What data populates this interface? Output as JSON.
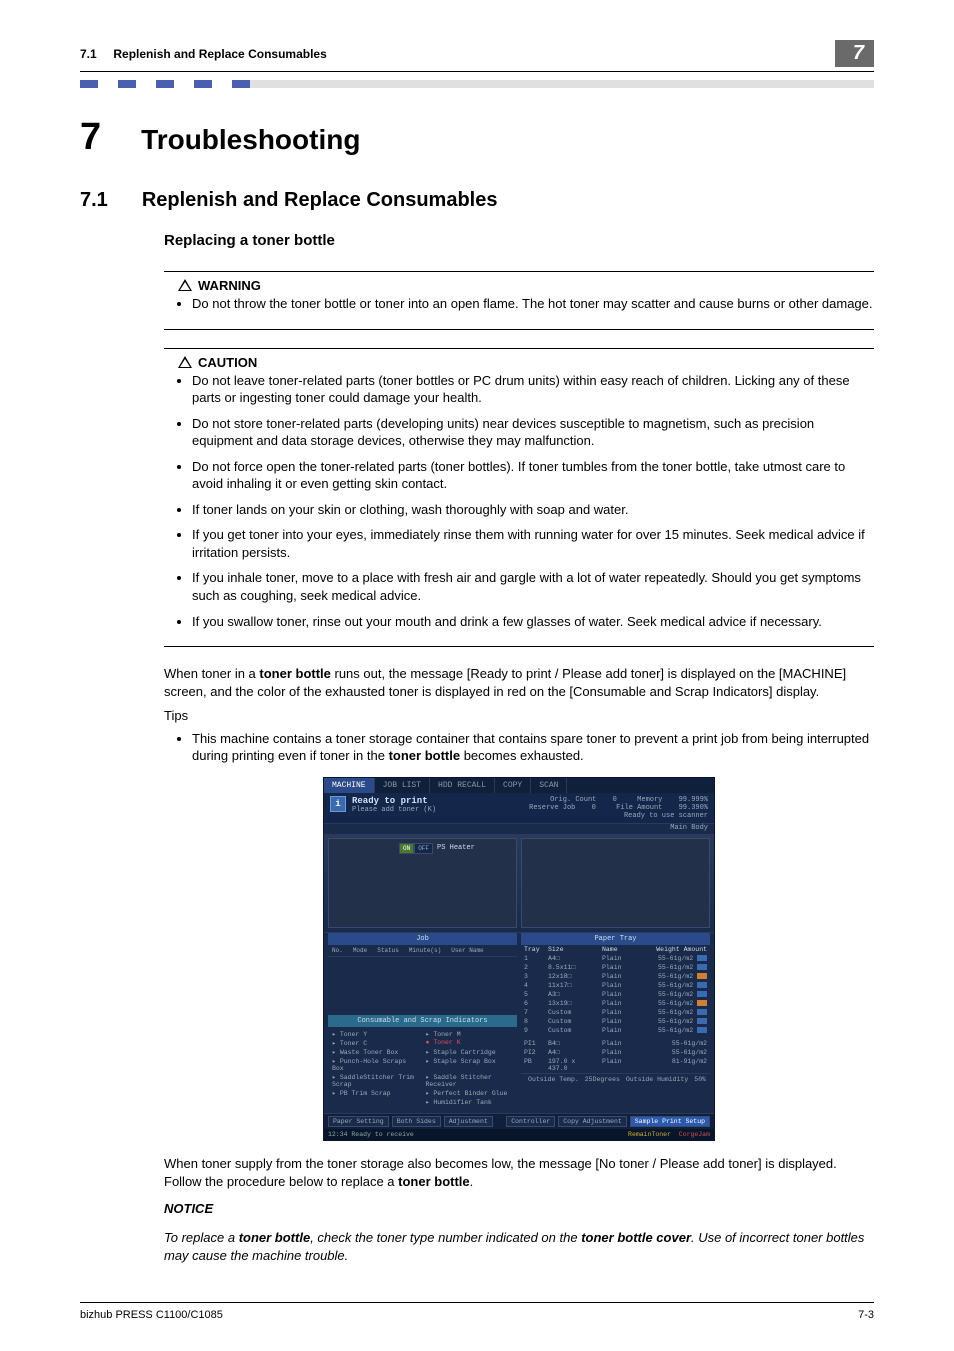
{
  "header": {
    "section_ref": "7.1",
    "section_name": "Replenish and Replace Consumables",
    "chapter_badge": "7"
  },
  "chapter": {
    "num": "7",
    "title": "Troubleshooting"
  },
  "section": {
    "num": "7.1",
    "title": "Replenish and Replace Consumables"
  },
  "subheading": "Replacing a toner bottle",
  "warning": {
    "label": "WARNING",
    "items": [
      "Do not throw the toner bottle or toner into an open flame. The hot toner may scatter and cause burns or other damage."
    ]
  },
  "caution": {
    "label": "CAUTION",
    "items": [
      "Do not leave toner-related parts (toner bottles or PC drum units) within easy reach of children. Licking any of these parts or ingesting toner could damage your health.",
      "Do not store toner-related parts (developing units) near devices susceptible to magnetism, such as precision equipment and data storage devices, otherwise they may malfunction.",
      "Do not force open the toner-related parts (toner bottles). If toner tumbles from the toner bottle, take utmost care to avoid inhaling it or even getting skin contact.",
      "If toner lands on your skin or clothing, wash thoroughly with soap and water.",
      "If you get toner into your eyes, immediately rinse them with running water for over 15 minutes. Seek medical advice if irritation persists.",
      "If you inhale toner, move to a place with fresh air and gargle with a lot of water repeatedly. Should you get symptoms such as coughing, seek medical advice.",
      "If you swallow toner, rinse out your mouth and drink a few glasses of water. Seek medical advice if necessary."
    ]
  },
  "body": {
    "p1a": "When toner in a ",
    "p1b": "toner bottle",
    "p1c": " runs out, the message [Ready to print / Please add toner] is displayed on the [MACHINE] screen, and the color of the exhausted toner is displayed in red on the [Consumable and Scrap Indicators] display.",
    "tips_label": "Tips",
    "tip1a": "This machine contains a toner storage container that contains spare toner to prevent a print job from being interrupted during printing even if toner in the ",
    "tip1b": "toner bottle",
    "tip1c": " becomes exhausted.",
    "p2a": "When toner supply from the toner storage also becomes low, the message [No toner / Please add toner] is displayed. Follow the procedure below to replace a ",
    "p2b": "toner bottle",
    "p2c": ".",
    "notice_head": "NOTICE",
    "notice_a": "To replace a ",
    "notice_b": "toner bottle",
    "notice_c": ", check the toner type number indicated on the ",
    "notice_d": "toner bottle cover",
    "notice_e": ". Use of incorrect toner bottles may cause the machine trouble."
  },
  "screen": {
    "tabs": [
      "MACHINE",
      "JOB LIST",
      "HDD RECALL",
      "COPY",
      "SCAN"
    ],
    "ready_l1": "Ready to print",
    "ready_l2": "Please add toner (K)",
    "main_body": "Main Body",
    "meta": {
      "orig_count_l": "Orig. Count",
      "orig_count_v": "0",
      "memory_l": "Memory",
      "memory_v": "99.999%",
      "reserve_l": "Reserve Job",
      "reserve_v": "0",
      "file_l": "File Amount",
      "file_v": "99.390%",
      "scanner": "Ready to use scanner"
    },
    "heater": {
      "on": "ON",
      "off": "OFF",
      "label": "PS Heater"
    },
    "job_head": "Job",
    "job_cols": [
      "No.",
      "Mode",
      "Status",
      "Minute(s)",
      "User Name"
    ],
    "tray_head": "Paper Tray",
    "tray_cols": [
      "Tray",
      "Size",
      "Name",
      "Weight",
      "Amount"
    ],
    "trays": [
      {
        "n": "1",
        "size": "A4□",
        "name": "Plain",
        "wt": "55-61g/m2",
        "amt": "norm"
      },
      {
        "n": "2",
        "size": "8.5x11□",
        "name": "Plain",
        "wt": "55-61g/m2",
        "amt": "norm"
      },
      {
        "n": "3",
        "size": "12x18□",
        "name": "Plain",
        "wt": "55-61g/m2",
        "amt": "low"
      },
      {
        "n": "4",
        "size": "11x17□",
        "name": "Plain",
        "wt": "55-61g/m2",
        "amt": "norm"
      },
      {
        "n": "5",
        "size": "A3□",
        "name": "Plain",
        "wt": "55-61g/m2",
        "amt": "norm"
      },
      {
        "n": "6",
        "size": "13x19□",
        "name": "Plain",
        "wt": "55-61g/m2",
        "amt": "low"
      },
      {
        "n": "7",
        "size": "Custom",
        "name": "Plain",
        "wt": "55-61g/m2",
        "amt": "norm"
      },
      {
        "n": "8",
        "size": "Custom",
        "name": "Plain",
        "wt": "55-61g/m2",
        "amt": "norm"
      },
      {
        "n": "9",
        "size": "Custom",
        "name": "Plain",
        "wt": "55-61g/m2",
        "amt": "norm"
      }
    ],
    "pi": [
      {
        "n": "PI1",
        "size": "B4□",
        "name": "Plain",
        "wt": "55-61g/m2"
      },
      {
        "n": "PI2",
        "size": "A4□",
        "name": "Plain",
        "wt": "55-61g/m2"
      },
      {
        "n": "PB",
        "size": "197.0 x 437.0",
        "name": "Plain",
        "wt": "81-91g/m2"
      }
    ],
    "cons_head": "Consumable and Scrap Indicators",
    "cons": {
      "l": [
        "Toner Y",
        "Toner C",
        "Waste Toner Box",
        "Punch-Hole Scraps Box",
        "SaddleStitcher Trim Scrap",
        "PB Trim Scrap"
      ],
      "r": [
        "Toner M",
        "Toner K",
        "Staple Cartridge",
        "Staple Scrap Box",
        "Saddle Stitcher Receiver",
        "Perfect Binder Glue",
        "Humidifier Tank"
      ]
    },
    "env": {
      "temp_l": "Outside Temp.",
      "temp_v": "25Degrees",
      "hum_l": "Outside Humidity",
      "hum_v": "50%"
    },
    "foot_btns_l": [
      "Paper Setting",
      "Both Sides",
      "Adjustment"
    ],
    "foot_btns_r": [
      "Controller",
      "Copy Adjustment",
      "Sample Print Setup"
    ],
    "status_l": "12:34  Ready to receive",
    "status_r1": "RemainToner",
    "status_r2": "CorgeJam"
  },
  "footer": {
    "left": "bizhub PRESS C1100/C1085",
    "right": "7-3"
  }
}
